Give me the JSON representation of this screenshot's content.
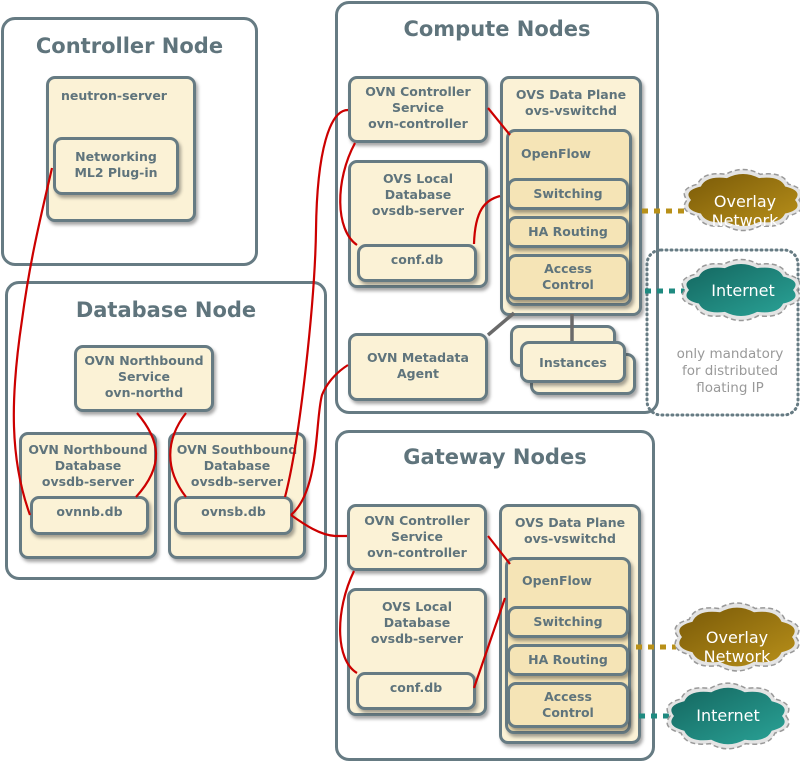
{
  "controller_node": {
    "title": "Controller Node",
    "neutron_server": "neutron-server",
    "ml2_plugin": [
      "Networking",
      "ML2 Plug-in"
    ]
  },
  "database_node": {
    "title": "Database Node",
    "northd": [
      "OVN Northbound",
      "Service",
      "ovn-northd"
    ],
    "nb_db": [
      "OVN Northbound",
      "Database",
      "ovsdb-server"
    ],
    "nb_file": "ovnnb.db",
    "sb_db": [
      "OVN Southbound",
      "Database",
      "ovsdb-server"
    ],
    "sb_file": "ovnsb.db"
  },
  "compute_nodes": {
    "title": "Compute Nodes",
    "controller": [
      "OVN Controller",
      "Service",
      "ovn-controller"
    ],
    "local_db": [
      "OVS Local",
      "Database",
      "ovsdb-server"
    ],
    "conf_db": "conf.db",
    "data_plane": [
      "OVS Data Plane",
      "ovs-vswitchd"
    ],
    "openflow": "OpenFlow",
    "switching": "Switching",
    "ha_routing": "HA Routing",
    "access_control": [
      "Access",
      "Control"
    ],
    "metadata_agent": [
      "OVN Metadata",
      "Agent"
    ],
    "instances": "Instances"
  },
  "gateway_nodes": {
    "title": "Gateway Nodes",
    "controller": [
      "OVN Controller",
      "Service",
      "ovn-controller"
    ],
    "local_db": [
      "OVS Local",
      "Database",
      "ovsdb-server"
    ],
    "conf_db": "conf.db",
    "data_plane": [
      "OVS Data Plane",
      "ovs-vswitchd"
    ],
    "openflow": "OpenFlow",
    "switching": "Switching",
    "ha_routing": "HA Routing",
    "access_control": [
      "Access",
      "Control"
    ]
  },
  "clouds": {
    "overlay": [
      "Overlay",
      "Network"
    ],
    "internet": "Internet"
  },
  "note": [
    "only mandatory",
    "for distributed",
    "floating IP"
  ],
  "colors": {
    "border": "#667b83",
    "box_fill": "#fbf2d6",
    "connector": "#cc0000",
    "overlay_cloud": "#a07a10",
    "internet_cloud": "#1e8a80"
  }
}
